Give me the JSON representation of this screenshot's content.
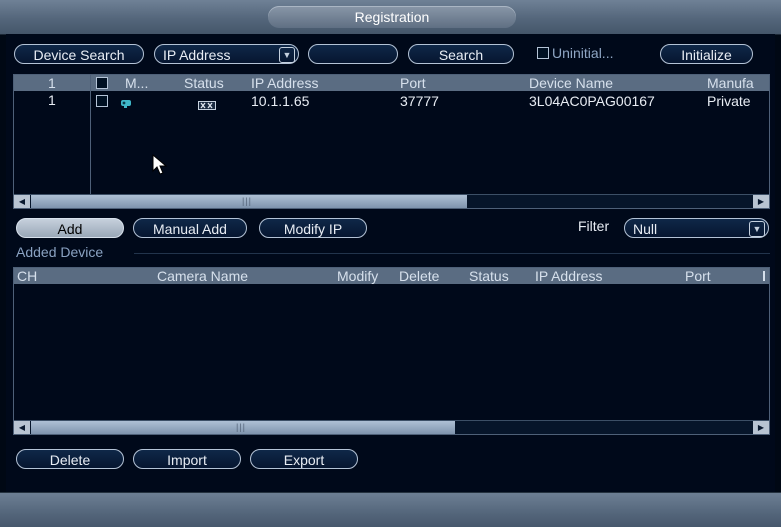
{
  "window": {
    "title": "Registration"
  },
  "toolbar": {
    "device_search": "Device Search",
    "protocol_select": "IP Address",
    "search_value": "",
    "search": "Search",
    "uninitialized_label": "Uninitial...",
    "initialize": "Initialize"
  },
  "search_table": {
    "header": {
      "index": "1",
      "mode": "M...",
      "status": "Status",
      "ip": "IP Address",
      "port": "Port",
      "device_name": "Device Name",
      "manufacturer": "Manufa"
    },
    "rows": [
      {
        "index": "1",
        "mode_icon": "camera-icon",
        "status_icon": "uninitialized-device-icon",
        "ip": "10.1.1.65",
        "port": "37777",
        "device_name": "3L04AC0PAG00167",
        "manufacturer": "Private"
      }
    ]
  },
  "actions": {
    "add": "Add",
    "manual_add": "Manual Add",
    "modify_ip": "Modify IP",
    "filter_label": "Filter",
    "filter_value": "Null"
  },
  "added_device": {
    "title": "Added Device",
    "header": {
      "ch": "CH",
      "camera_name": "Camera Name",
      "modify": "Modify",
      "delete": "Delete",
      "status": "Status",
      "ip": "IP Address",
      "port": "Port"
    },
    "rows": []
  },
  "bottom": {
    "delete": "Delete",
    "import": "Import",
    "export": "Export"
  },
  "colors": {
    "background": "#00091a",
    "header_bar": "#5a6c82",
    "header_text": "#9ab0cc",
    "text": "#e8edf4"
  }
}
